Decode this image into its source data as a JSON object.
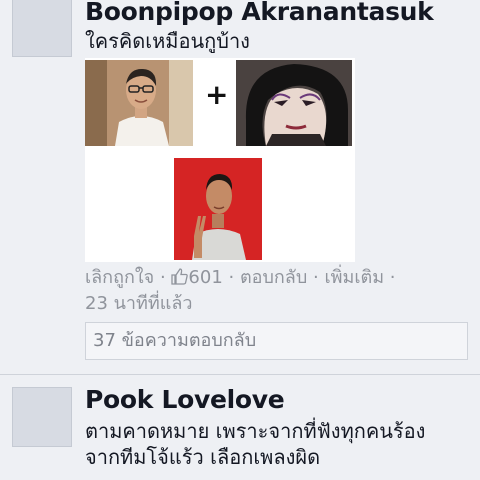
{
  "comments": [
    {
      "author": "Boonpipop Akranantasuk",
      "text": [
        "ใครคิดเหมือนกูบ้าง"
      ],
      "photo": {
        "plus_sign": "+"
      },
      "actions": {
        "unlike": "เลิกถูกใจ",
        "sep": "·",
        "like_count": "601",
        "reply": "ตอบกลับ",
        "more": "เพิ่มเติม",
        "time": "23 นาทีที่แล้ว"
      },
      "replies_link": "37 ข้อความตอบกลับ"
    },
    {
      "author": "Pook Lovelove",
      "text": [
        "ตามคาดหมาย เพราะจากที่ฟังทุกคนร้อง",
        "จากทีมโจ้แร้ว เลือกเพลงผิด"
      ]
    }
  ]
}
